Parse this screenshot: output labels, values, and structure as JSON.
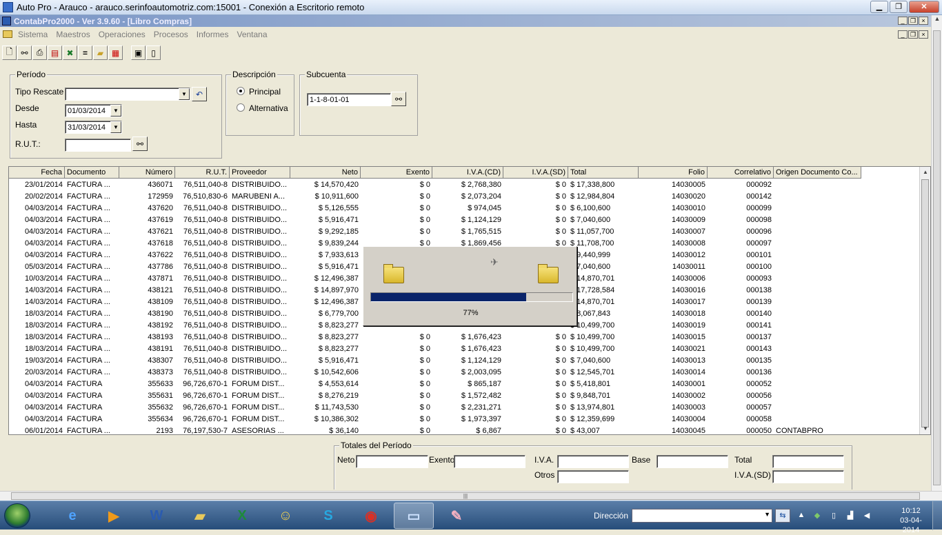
{
  "rdp_window": {
    "title": "Auto Pro - Arauco - arauco.serinfoautomotriz.com:15001 - Conexión a Escritorio remoto"
  },
  "app": {
    "title": "ContabPro2000 - Ver 3.9.60 - [Libro Compras]",
    "menu": [
      "Sistema",
      "Maestros",
      "Operaciones",
      "Procesos",
      "Informes",
      "Ventana"
    ]
  },
  "toolbar": {
    "icons": [
      "new-document-icon",
      "binoculars-icon",
      "print-icon",
      "printer-red-icon",
      "excel-export-icon",
      "equals-icon",
      "open-folder-icon",
      "grid-icon",
      "properties-icon",
      "exit-icon"
    ]
  },
  "periodo": {
    "legend": "Período",
    "tipo_rescate_label": "Tipo Rescate",
    "tipo_rescate_value": "",
    "desde_label": "Desde",
    "desde_value": "01/03/2014",
    "hasta_label": "Hasta",
    "hasta_value": "31/03/2014",
    "rut_label": "R.U.T.:",
    "rut_value": ""
  },
  "descripcion": {
    "legend": "Descripción",
    "options": [
      "Principal",
      "Alternativa"
    ],
    "selected": "Principal"
  },
  "subcuenta": {
    "legend": "Subcuenta",
    "value": "1-1-8-01-01"
  },
  "grid": {
    "columns": [
      "Fecha",
      "Documento",
      "Número",
      "R.U.T.",
      "Proveedor",
      "Neto",
      "Exento",
      "I.V.A.(CD)",
      "I.V.A.(SD)",
      "Total",
      "Folio",
      "Correlativo",
      "Origen Documento Co..."
    ],
    "rows": [
      [
        "23/01/2014",
        "FACTURA ...",
        "436071",
        "76,511,040-8",
        "DISTRIBUIDO...",
        "$ 14,570,420",
        "$ 0",
        "$ 2,768,380",
        "$ 0",
        "$ 17,338,800",
        "14030005",
        "000092",
        ""
      ],
      [
        "20/02/2014",
        "FACTURA ...",
        "172959",
        "76,510,830-6",
        "MARUBENI A...",
        "$ 10,911,600",
        "$ 0",
        "$ 2,073,204",
        "$ 0",
        "$ 12,984,804",
        "14030020",
        "000142",
        ""
      ],
      [
        "04/03/2014",
        "FACTURA ...",
        "437620",
        "76,511,040-8",
        "DISTRIBUIDO...",
        "$ 5,126,555",
        "$ 0",
        "$ 974,045",
        "$ 0",
        "$ 6,100,600",
        "14030010",
        "000099",
        ""
      ],
      [
        "04/03/2014",
        "FACTURA ...",
        "437619",
        "76,511,040-8",
        "DISTRIBUIDO...",
        "$ 5,916,471",
        "$ 0",
        "$ 1,124,129",
        "$ 0",
        "$ 7,040,600",
        "14030009",
        "000098",
        ""
      ],
      [
        "04/03/2014",
        "FACTURA ...",
        "437621",
        "76,511,040-8",
        "DISTRIBUIDO...",
        "$ 9,292,185",
        "$ 0",
        "$ 1,765,515",
        "$ 0",
        "$ 11,057,700",
        "14030007",
        "000096",
        ""
      ],
      [
        "04/03/2014",
        "FACTURA ...",
        "437618",
        "76,511,040-8",
        "DISTRIBUIDO...",
        "$ 9,839,244",
        "$ 0",
        "$ 1,869,456",
        "$ 0",
        "$ 11,708,700",
        "14030008",
        "000097",
        ""
      ],
      [
        "04/03/2014",
        "FACTURA ...",
        "437622",
        "76,511,040-8",
        "DISTRIBUIDO...",
        "$ 7,933,613",
        "",
        "",
        "",
        "$ 9,440,999",
        "14030012",
        "000101",
        ""
      ],
      [
        "05/03/2014",
        "FACTURA ...",
        "437786",
        "76,511,040-8",
        "DISTRIBUIDO...",
        "$ 5,916,471",
        "",
        "",
        "",
        "$ 7,040,600",
        "14030011",
        "000100",
        ""
      ],
      [
        "10/03/2014",
        "FACTURA ...",
        "437871",
        "76,511,040-8",
        "DISTRIBUIDO...",
        "$ 12,496,387",
        "",
        "",
        "",
        "$ 14,870,701",
        "14030006",
        "000093",
        ""
      ],
      [
        "14/03/2014",
        "FACTURA ...",
        "438121",
        "76,511,040-8",
        "DISTRIBUIDO...",
        "$ 14,897,970",
        "",
        "",
        "",
        "$ 17,728,584",
        "14030016",
        "000138",
        ""
      ],
      [
        "14/03/2014",
        "FACTURA ...",
        "438109",
        "76,511,040-8",
        "DISTRIBUIDO...",
        "$ 12,496,387",
        "",
        "",
        "",
        "$ 14,870,701",
        "14030017",
        "000139",
        ""
      ],
      [
        "18/03/2014",
        "FACTURA ...",
        "438190",
        "76,511,040-8",
        "DISTRIBUIDO...",
        "$ 6,779,700",
        "",
        "",
        "",
        "$ 8,067,843",
        "14030018",
        "000140",
        ""
      ],
      [
        "18/03/2014",
        "FACTURA ...",
        "438192",
        "76,511,040-8",
        "DISTRIBUIDO...",
        "$ 8,823,277",
        "",
        "",
        "",
        "$ 10,499,700",
        "14030019",
        "000141",
        ""
      ],
      [
        "18/03/2014",
        "FACTURA ...",
        "438193",
        "76,511,040-8",
        "DISTRIBUIDO...",
        "$ 8,823,277",
        "$ 0",
        "$ 1,676,423",
        "$ 0",
        "$ 10,499,700",
        "14030015",
        "000137",
        ""
      ],
      [
        "18/03/2014",
        "FACTURA ...",
        "438191",
        "76,511,040-8",
        "DISTRIBUIDO...",
        "$ 8,823,277",
        "$ 0",
        "$ 1,676,423",
        "$ 0",
        "$ 10,499,700",
        "14030021",
        "000143",
        ""
      ],
      [
        "19/03/2014",
        "FACTURA ...",
        "438307",
        "76,511,040-8",
        "DISTRIBUIDO...",
        "$ 5,916,471",
        "$ 0",
        "$ 1,124,129",
        "$ 0",
        "$ 7,040,600",
        "14030013",
        "000135",
        ""
      ],
      [
        "20/03/2014",
        "FACTURA ...",
        "438373",
        "76,511,040-8",
        "DISTRIBUIDO...",
        "$ 10,542,606",
        "$ 0",
        "$ 2,003,095",
        "$ 0",
        "$ 12,545,701",
        "14030014",
        "000136",
        ""
      ],
      [
        "04/03/2014",
        "FACTURA",
        "355633",
        "96,726,670-1",
        "FORUM DIST...",
        "$ 4,553,614",
        "$ 0",
        "$ 865,187",
        "$ 0",
        "$ 5,418,801",
        "14030001",
        "000052",
        ""
      ],
      [
        "04/03/2014",
        "FACTURA",
        "355631",
        "96,726,670-1",
        "FORUM DIST...",
        "$ 8,276,219",
        "$ 0",
        "$ 1,572,482",
        "$ 0",
        "$ 9,848,701",
        "14030002",
        "000056",
        ""
      ],
      [
        "04/03/2014",
        "FACTURA",
        "355632",
        "96,726,670-1",
        "FORUM DIST...",
        "$ 11,743,530",
        "$ 0",
        "$ 2,231,271",
        "$ 0",
        "$ 13,974,801",
        "14030003",
        "000057",
        ""
      ],
      [
        "04/03/2014",
        "FACTURA",
        "355634",
        "96,726,670-1",
        "FORUM DIST...",
        "$ 10,386,302",
        "$ 0",
        "$ 1,973,397",
        "$ 0",
        "$ 12,359,699",
        "14030004",
        "000058",
        ""
      ],
      [
        "06/01/2014",
        "FACTURA ...",
        "2193",
        "76,197,530-7",
        "ASESORIAS ...",
        "$ 36,140",
        "$ 0",
        "$ 6,867",
        "$ 0",
        "$ 43,007",
        "14030045",
        "000050",
        "CONTABPRO"
      ]
    ]
  },
  "progress": {
    "percent_label": "77%",
    "fraction": 0.77
  },
  "totales": {
    "legend": "Totales del Período",
    "neto_label": "Neto",
    "exento_label": "Exento",
    "iva_label": "I.V.A.",
    "base_label": "Base",
    "total_label": "Total",
    "otros_label": "Otros",
    "iva_sd_label": "I.V.A.(SD)"
  },
  "taskbar": {
    "direccion_label": "Dirección",
    "time": "10:12",
    "date": "03-04-2014"
  }
}
